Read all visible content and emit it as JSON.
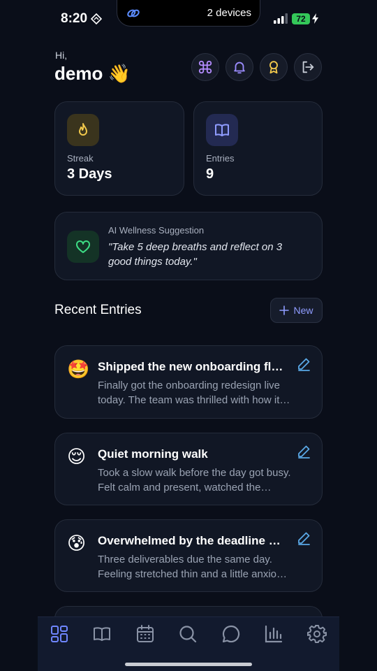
{
  "status": {
    "time": "8:20",
    "island_text": "2 devices",
    "battery": "72"
  },
  "header": {
    "greeting": "Hi,",
    "username": "demo 👋"
  },
  "stats": {
    "streak": {
      "label": "Streak",
      "value": "3 Days"
    },
    "entries": {
      "label": "Entries",
      "value": "9"
    }
  },
  "ai": {
    "title": "AI Wellness Suggestion",
    "quote": "\"Take 5 deep breaths and reflect on 3 good things today.\""
  },
  "recent": {
    "title": "Recent Entries",
    "new_label": "New"
  },
  "entries": [
    {
      "emoji": "🤩",
      "title": "Shipped the new onboarding flow",
      "body": "Finally got the onboarding redesign live today. The team was thrilled with how it turned out."
    },
    {
      "emoji": "😌",
      "title": "Quiet morning walk",
      "body": "Took a slow walk before the day got busy. Felt calm and present, watched the sunrise."
    },
    {
      "emoji": "😰",
      "title": "Overwhelmed by the deadline crunch",
      "body": "Three deliverables due the same day. Feeling stretched thin and a little anxious about it."
    }
  ],
  "colors": {
    "background": "#0a0e19",
    "accent": "#8f9cff",
    "streak": "#f2c94c",
    "wellness": "#3ddc84",
    "edit": "#5aa8e6"
  },
  "icons": {
    "header": [
      "command-icon",
      "bell-icon",
      "award-icon",
      "logout-icon"
    ],
    "tabs": [
      "grid-icon",
      "book-icon",
      "calendar-icon",
      "search-icon",
      "chat-icon",
      "chart-icon",
      "settings-icon"
    ]
  }
}
